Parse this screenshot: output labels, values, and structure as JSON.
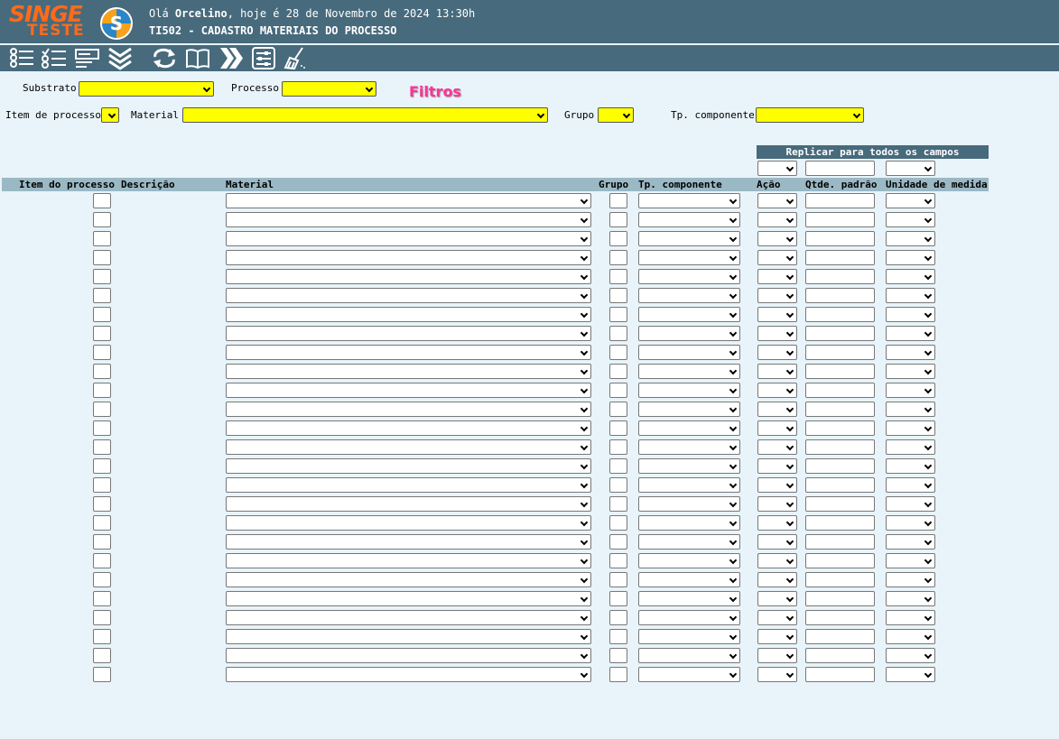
{
  "header": {
    "logo_line1": "SINGE",
    "logo_line2": "TESTE",
    "greeting_prefix": "Olá ",
    "user_name": "Orcelino",
    "greeting_suffix": ", hoje é 28 de Novembro de 2024 13:30h",
    "page_title": "TI502 - CADASTRO MATERIAIS DO PROCESSO",
    "brand_color": "#ff6a1a",
    "bar_color": "#476a7c"
  },
  "toolbar": {
    "buttons": [
      "list-icon",
      "checklist-icon",
      "form-icon",
      "double-chevron-down-icon",
      "refresh-icon",
      "book-icon",
      "double-chevron-right-icon",
      "settings-sliders-icon",
      "broom-icon"
    ]
  },
  "filters": {
    "title": "Filtros",
    "substrato_label": "Substrato",
    "processo_label": "Processo",
    "item_processo_label": "Item de processo",
    "material_label": "Material",
    "grupo_label": "Grupo",
    "tp_componente_label": "Tp. componente",
    "field_color": "#ffff00"
  },
  "replicate": {
    "title": "Replicar para todos os campos"
  },
  "table": {
    "columns": [
      "Item do processo",
      "Descrição",
      "Material",
      "Grupo",
      "Tp. componente",
      "Ação",
      "Qtde. padrão",
      "Unidade de medida"
    ],
    "row_count": 26
  }
}
